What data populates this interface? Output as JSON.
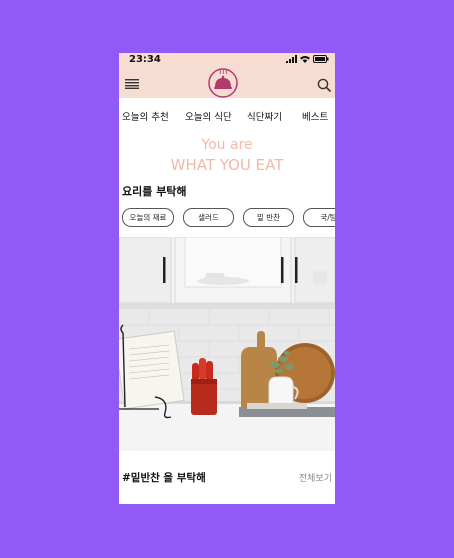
{
  "status": {
    "time": "23:34"
  },
  "nav": {
    "tabs": [
      {
        "label": "오늘의 추천"
      },
      {
        "label": "오늘의 식단"
      },
      {
        "label": "식단짜기"
      },
      {
        "label": "베스트"
      }
    ]
  },
  "hero": {
    "line1": "You are",
    "line2": "WHAT YOU EAT"
  },
  "section": {
    "title": "요리를 부탁해"
  },
  "chips": [
    {
      "label": "오늘의 재료"
    },
    {
      "label": "샐러드"
    },
    {
      "label": "밑 반찬"
    },
    {
      "label": "국/탕"
    }
  ],
  "footer": {
    "title": "#밑반찬 을 부탁해",
    "view_all": "전체보기"
  },
  "colors": {
    "background": "#9159f5",
    "header": "#f7ddd1",
    "logo": "#b23a6a",
    "accent_text": "#f2b9a6"
  },
  "icons": [
    "menu-icon",
    "cloche-logo-icon",
    "search-icon",
    "signal-icon",
    "wifi-icon",
    "battery-icon"
  ]
}
